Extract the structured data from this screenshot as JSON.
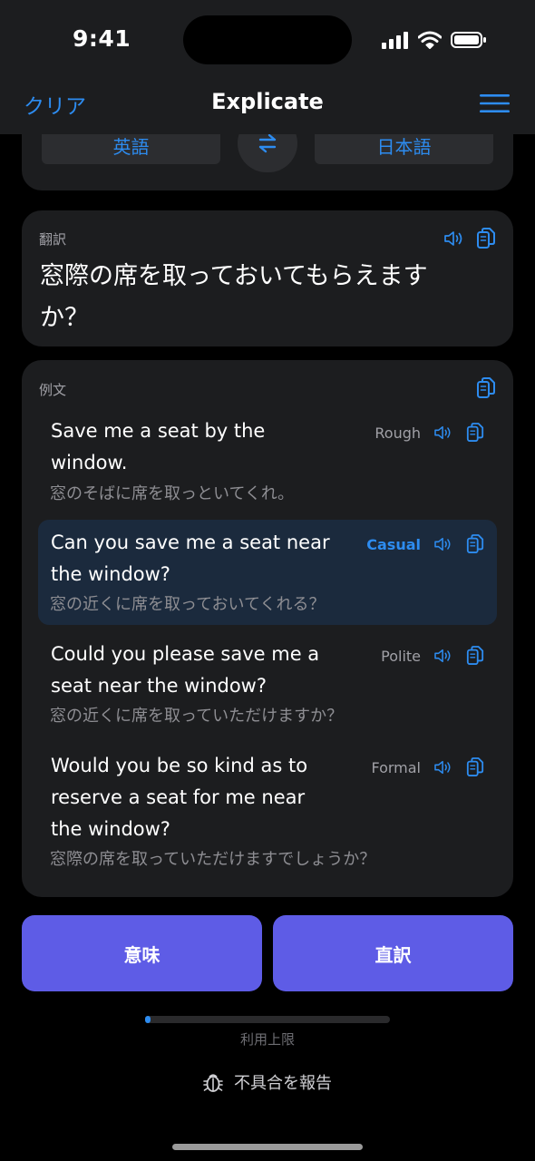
{
  "status_bar": {
    "time": "9:41"
  },
  "nav": {
    "left_label": "クリア",
    "title": "Explicate",
    "menu_icon": "hamburger-menu-icon"
  },
  "languages": {
    "source": "英語",
    "target": "日本語",
    "swap_icon": "swap-arrows-icon"
  },
  "translation": {
    "label": "翻訳",
    "text": "窓際の席を取っておいてもらえますか？"
  },
  "examples": {
    "label": "例文",
    "items": [
      {
        "en": "Save me a seat by the window.",
        "ja": "窓のそばに席を取っといてくれ。",
        "tag": "Rough",
        "selected": false
      },
      {
        "en": "Can you save me a seat near the window?",
        "ja": "窓の近くに席を取っておいてくれる？",
        "tag": "Casual",
        "selected": true
      },
      {
        "en": "Could you please save me a seat near the window?",
        "ja": "窓の近くに席を取っていただけますか？",
        "tag": "Polite",
        "selected": false
      },
      {
        "en": "Would you be so kind as to reserve a seat for me near the window?",
        "ja": "窓際の席を取っていただけますでしょうか？",
        "tag": "Formal",
        "selected": false
      }
    ]
  },
  "buttons": {
    "meaning": "意味",
    "literal": "直訳"
  },
  "usage": {
    "label": "利用上限",
    "fraction": 0.02
  },
  "report": {
    "label": "不具合を報告",
    "icon": "bug-icon"
  },
  "colors": {
    "accent": "#2d8cf0",
    "button_purple": "#5e5ce6",
    "card": "#1c1d1f",
    "selected_row": "#1b2a3d"
  }
}
